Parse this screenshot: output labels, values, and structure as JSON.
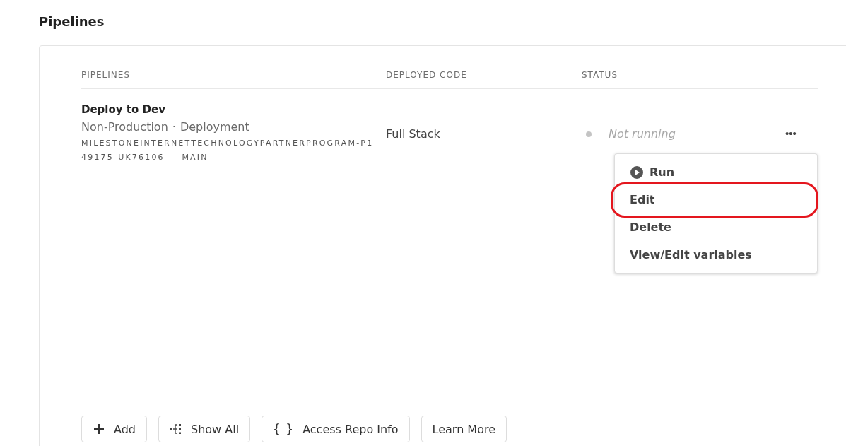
{
  "title": "Pipelines",
  "table": {
    "columns": [
      "PIPELINES",
      "DEPLOYED CODE",
      "STATUS"
    ],
    "rows": [
      {
        "name": "Deploy to Dev",
        "type": "Non-Production",
        "separator": "·",
        "kind": "Deployment",
        "repo": "MILESTONEINTERNETTECHNOLOGYPARTNERPROGRAM-P149175-UK76106 — MAIN",
        "code": "Full Stack",
        "status": "Not running",
        "more": "•••"
      }
    ]
  },
  "menu": [
    {
      "label": "Run",
      "kind": "play",
      "highlighted": false
    },
    {
      "label": "Edit",
      "kind": "plain",
      "highlighted": true
    },
    {
      "label": "Delete",
      "kind": "plain",
      "highlighted": false
    },
    {
      "label": "View/Edit variables",
      "kind": "plain",
      "highlighted": false
    }
  ],
  "buttons": [
    {
      "label": "Add",
      "kind": "plus"
    },
    {
      "label": "Show All",
      "kind": "list"
    },
    {
      "label": "Access Repo Info",
      "kind": "glyph",
      "glyph": "{ }"
    },
    {
      "label": "Learn More",
      "kind": "plain"
    }
  ]
}
